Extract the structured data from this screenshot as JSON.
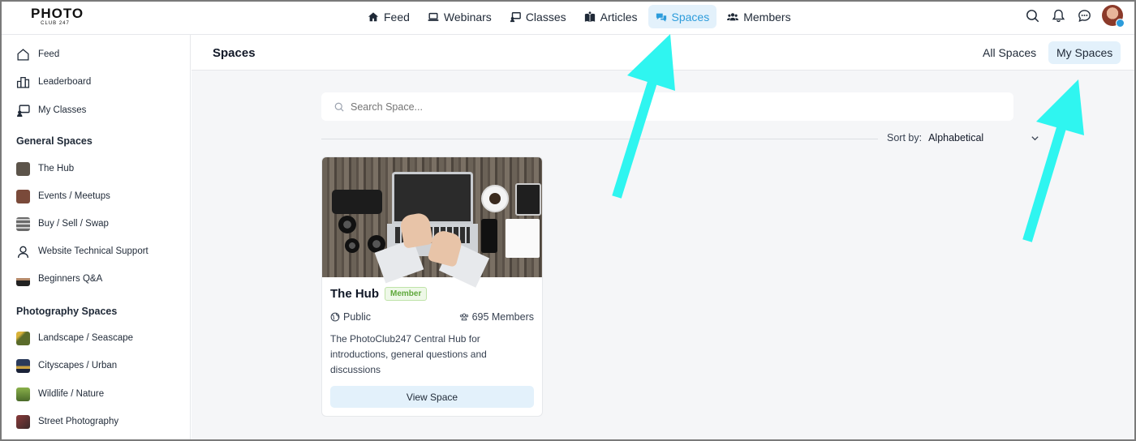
{
  "logo": {
    "main": "PHOTO",
    "sub": "CLUB 247"
  },
  "nav": [
    {
      "label": "Feed",
      "icon": "home-icon"
    },
    {
      "label": "Webinars",
      "icon": "laptop-icon"
    },
    {
      "label": "Classes",
      "icon": "classroom-icon"
    },
    {
      "label": "Articles",
      "icon": "book-icon"
    },
    {
      "label": "Spaces",
      "icon": "chat-bubbles-icon",
      "active": true
    },
    {
      "label": "Members",
      "icon": "users-icon"
    }
  ],
  "sidebar": {
    "top_items": [
      {
        "label": "Feed",
        "icon": "home-icon"
      },
      {
        "label": "Leaderboard",
        "icon": "bar-chart-icon"
      },
      {
        "label": "My Classes",
        "icon": "classroom-icon"
      }
    ],
    "general_heading": "General Spaces",
    "general_items": [
      {
        "label": "The Hub",
        "color": "#5c544a"
      },
      {
        "label": "Events / Meetups",
        "color": "#7a4a3a"
      },
      {
        "label": "Buy / Sell / Swap",
        "color": "#6b6b6b"
      },
      {
        "label": "Website Technical Support",
        "icon": "user-outline-icon"
      },
      {
        "label": "Beginners Q&A",
        "color": "#b58a6a"
      }
    ],
    "photo_heading": "Photography Spaces",
    "photo_items": [
      {
        "label": "Landscape / Seascape",
        "color": "#5a6b2a"
      },
      {
        "label": "Cityscapes / Urban",
        "color": "#2a3a5a"
      },
      {
        "label": "Wildlife / Nature",
        "color": "#6a8a3a"
      },
      {
        "label": "Street Photography",
        "color": "#8a3a3a"
      }
    ]
  },
  "main": {
    "title": "Spaces",
    "tabs": {
      "all": "All Spaces",
      "mine": "My Spaces"
    },
    "search_placeholder": "Search Space...",
    "sort_label": "Sort by:",
    "sort_value": "Alphabetical"
  },
  "card": {
    "title": "The Hub",
    "badge": "Member",
    "visibility": "Public",
    "members": "695 Members",
    "description": "The PhotoClub247 Central Hub for introductions, general questions and discussions",
    "button": "View Space"
  },
  "colors": {
    "accent": "#2d9cdb",
    "arrow": "#2ff5f0",
    "badge_green": "#5fa83b"
  }
}
